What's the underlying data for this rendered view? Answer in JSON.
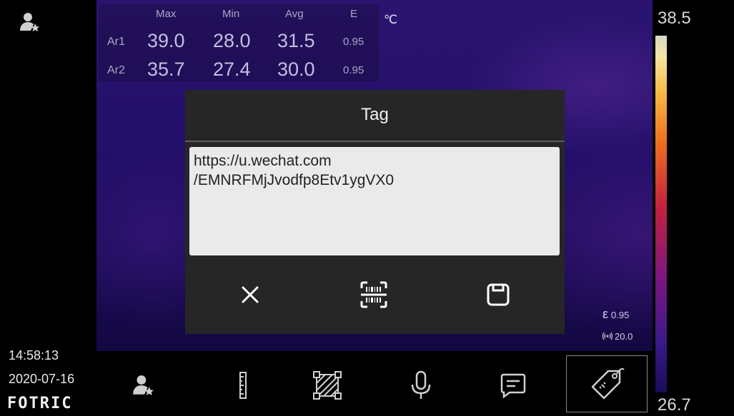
{
  "status": {
    "time": "14:58:13",
    "date": "2020-07-16",
    "brand": "FOTRIC"
  },
  "measurements": {
    "headers": [
      "Max",
      "Min",
      "Avg",
      "E"
    ],
    "unit": "℃",
    "rows": [
      {
        "label": "Ar1",
        "max": "39.0",
        "min": "28.0",
        "avg": "31.5",
        "e": "0.95"
      },
      {
        "label": "Ar2",
        "max": "35.7",
        "min": "27.4",
        "avg": "30.0",
        "e": "0.95"
      }
    ]
  },
  "scale": {
    "max": "38.5",
    "min": "26.7"
  },
  "info": {
    "emissivity": "0.95",
    "distance": "20.0"
  },
  "dialog": {
    "title": "Tag",
    "text": "https://u.wechat.com\n/EMNRFMjJvodfp8Etv1ygVX0",
    "buttons": [
      "close-icon",
      "barcode-scan-icon",
      "save-icon"
    ]
  },
  "toolbar": {
    "items": [
      "user-icon",
      "ruler-icon",
      "area-icon",
      "microphone-icon",
      "comment-icon",
      "tag-icon"
    ],
    "selected": "tag-icon"
  },
  "colors": {
    "dialog_bg": "#262626",
    "textbox_bg": "#eaeaea",
    "thermal_bg": "#23106a"
  }
}
